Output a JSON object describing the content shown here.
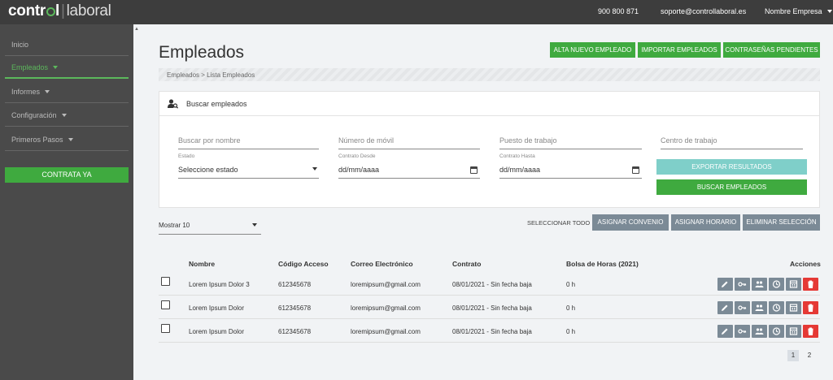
{
  "brand": {
    "part1": "contr",
    "part2": "l",
    "part3": "laboral"
  },
  "topbar": {
    "phone": "900 800 871",
    "email": "soporte@controllaboral.es",
    "company": "Nombre Empresa"
  },
  "sidebar": {
    "items": [
      {
        "label": "Inicio"
      },
      {
        "label": "Empleados"
      },
      {
        "label": "Informes"
      },
      {
        "label": "Configuración"
      },
      {
        "label": "Primeros Pasos"
      }
    ],
    "cta": "CONTRATA YA"
  },
  "page": {
    "title": "Empleados",
    "breadcrumb": "Empleados > Lista Empleados"
  },
  "header_buttons": [
    "ALTA NUEVO EMPLEADO",
    "IMPORTAR EMPLEADOS",
    "CONTRASEÑAS PENDIENTES"
  ],
  "search": {
    "title": "Buscar empleados",
    "nombre_placeholder": "Buscar por nombre",
    "movil_placeholder": "Número de móvil",
    "puesto_placeholder": "Puesto de trabajo",
    "centro_placeholder": "Centro de trabajo",
    "estado_label": "Estado",
    "estado_value": "Seleccione estado",
    "desde_label": "Contrato Desde",
    "desde_value": "dd/mm/aaaa",
    "hasta_label": "Contrato Hasta",
    "hasta_value": "dd/mm/aaaa",
    "export_button": "EXPORTAR RESULTADOS",
    "search_button": "BUSCAR EMPLEADOS"
  },
  "list_controls": {
    "mostrar": "Mostrar 10",
    "select_all": "SELECCIONAR TODO",
    "buttons": [
      "ASIGNAR CONVENIO",
      "ASIGNAR HORARIO",
      "ELIMINAR SELECCIÓN"
    ]
  },
  "table": {
    "headers": [
      "Nombre",
      "Código Acceso",
      "Correo Electrónico",
      "Contrato",
      "Bolsa de Horas (2021)",
      "Acciones"
    ],
    "rows": [
      [
        "Lorem Ipsum Dolor 3",
        "612345678",
        "loremipsum@gmail.com",
        "08/01/2021 - Sin fecha baja",
        "0 h"
      ],
      [
        "Lorem Ipsum Dolor",
        "612345678",
        "loremipsum@gmail.com",
        "08/01/2021 - Sin fecha baja",
        "0 h"
      ],
      [
        "Lorem Ipsum Dolor",
        "612345678",
        "loremipsum@gmail.com",
        "08/01/2021 - Sin fecha baja",
        "0 h"
      ]
    ],
    "action_icons": [
      "edit-icon",
      "key-icon",
      "group-icon",
      "clock-icon",
      "schedule-icon",
      "delete-icon"
    ]
  },
  "pagination": {
    "pages": [
      "1",
      "2"
    ],
    "current": "1"
  },
  "colors": {
    "primary": "#3faa3f",
    "secondary": "#7b8a96",
    "danger": "#e53935",
    "export": "#7fcfc9",
    "sidebar": "#4a4a4a",
    "topbar": "#3d3d3d"
  }
}
